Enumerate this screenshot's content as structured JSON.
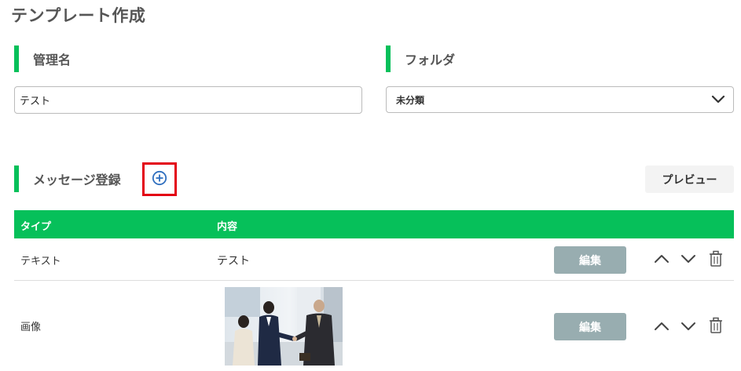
{
  "page": {
    "title": "テンプレート作成"
  },
  "management": {
    "label": "管理名",
    "value": "テスト"
  },
  "folder": {
    "label": "フォルダ",
    "selected": "未分類"
  },
  "messages": {
    "label": "メッセージ登録",
    "preview_label": "プレビュー",
    "columns": {
      "type": "タイプ",
      "content": "内容"
    },
    "rows": [
      {
        "type": "テキスト",
        "content": "テスト",
        "edit_label": "編集"
      },
      {
        "type": "画像",
        "content": "",
        "edit_label": "編集"
      }
    ]
  },
  "colors": {
    "accent": "#06c05a",
    "highlight": "#e30013",
    "edit_button": "#98adb0",
    "add_icon": "#2f6fbf"
  },
  "icons": [
    "plus-circle-icon",
    "chevron-down-icon",
    "arrow-up-icon",
    "arrow-down-icon",
    "trash-icon"
  ]
}
